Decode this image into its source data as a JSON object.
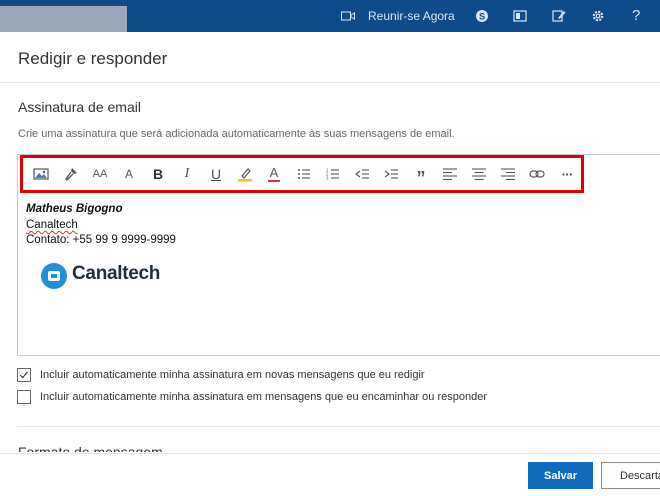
{
  "topbar": {
    "meet_label": "Reunir-se Agora",
    "icons": [
      "video-camera-icon",
      "skype-icon",
      "office-icon",
      "compose-icon",
      "gear-icon",
      "help-icon"
    ],
    "help_glyph": "?"
  },
  "page_title": "Redigir e responder",
  "signature_section": {
    "title": "Assinatura de email",
    "description": "Crie uma assinatura que será adicionada automaticamente às suas mensagens de email."
  },
  "toolbar": {
    "buttons": [
      {
        "name": "insert-image-icon"
      },
      {
        "name": "format-painter-icon"
      },
      {
        "name": "font-size-icon",
        "glyph": "AA"
      },
      {
        "name": "grow-font-icon",
        "glyph": "A"
      },
      {
        "name": "bold-icon",
        "glyph": "B"
      },
      {
        "name": "italic-icon",
        "glyph": "I"
      },
      {
        "name": "underline-icon",
        "glyph": "U"
      },
      {
        "name": "highlight-icon"
      },
      {
        "name": "font-color-icon",
        "glyph": "A"
      },
      {
        "name": "bullets-icon"
      },
      {
        "name": "numbering-icon"
      },
      {
        "name": "decrease-indent-icon"
      },
      {
        "name": "increase-indent-icon"
      },
      {
        "name": "quote-icon",
        "glyph": "”"
      },
      {
        "name": "align-left-icon"
      },
      {
        "name": "align-center-icon"
      },
      {
        "name": "align-right-icon"
      },
      {
        "name": "link-icon"
      },
      {
        "name": "more-icon",
        "glyph": "···"
      }
    ],
    "highlight_color": "#e00000"
  },
  "signature": {
    "name": "Matheus Bigogno",
    "company": "Canaltech",
    "contact": "Contato: +55 99 9 9999-9999",
    "logo_text": "Canaltech",
    "logo_color": "#1f8fd6"
  },
  "options": [
    {
      "label": "Incluir automaticamente minha assinatura em novas mensagens que eu redigir",
      "checked": true
    },
    {
      "label": "Incluir automaticamente minha assinatura em mensagens que eu encaminhar ou responder",
      "checked": false
    }
  ],
  "next_section_title": "Formato de mensagem",
  "footer": {
    "save_label": "Salvar",
    "discard_label": "Descartar"
  },
  "colors": {
    "topbar": "#0f4a8a",
    "primary": "#0f6cbd"
  }
}
